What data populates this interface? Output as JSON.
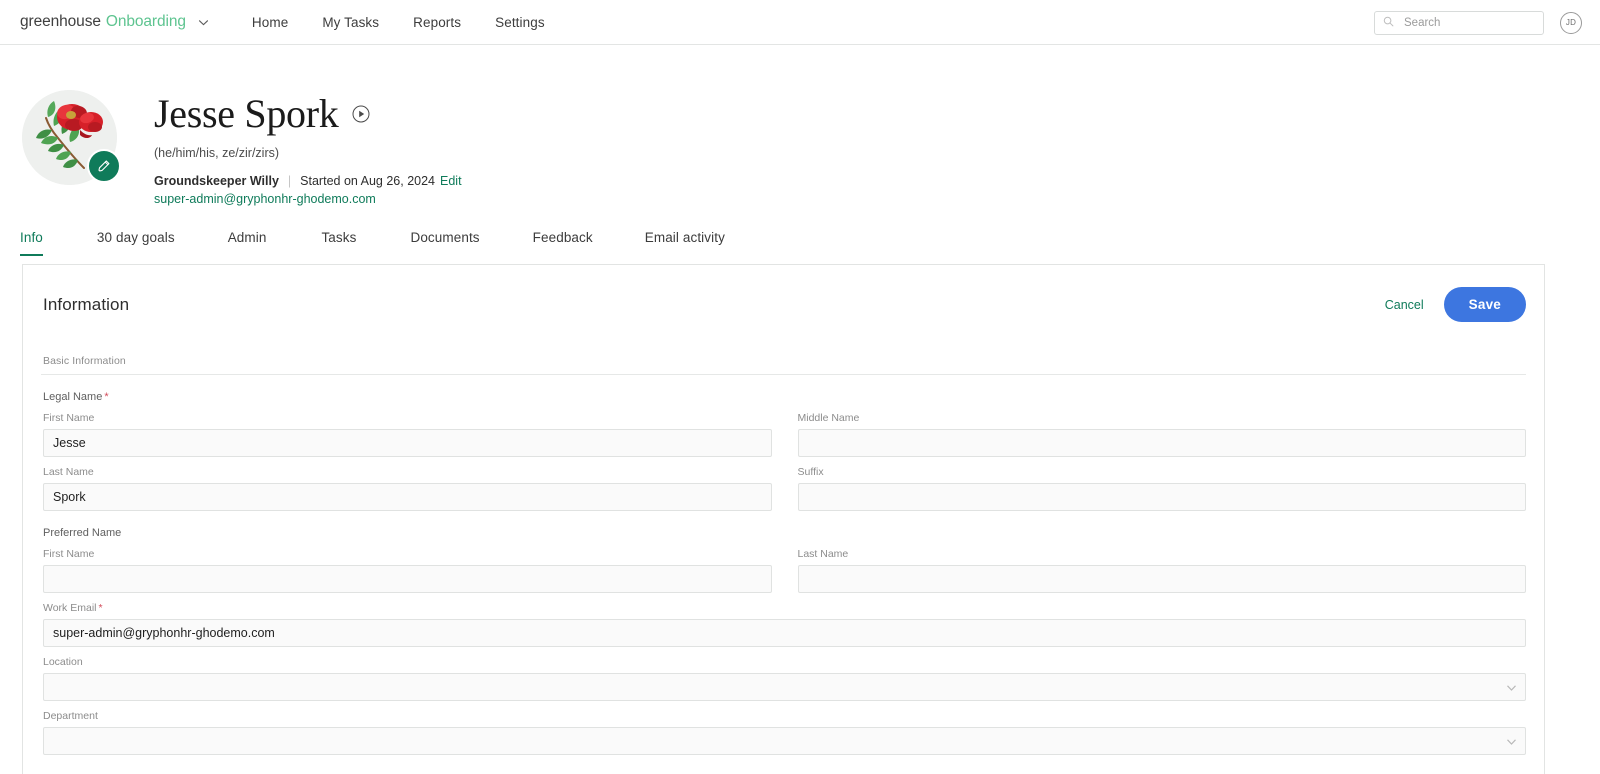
{
  "nav": {
    "brand_company": "greenhouse",
    "brand_product": "Onboarding",
    "brand_caret_icon": "chevron-down-icon",
    "links": [
      {
        "label": "Home"
      },
      {
        "label": "My Tasks"
      },
      {
        "label": "Reports"
      },
      {
        "label": "Settings"
      }
    ],
    "search": {
      "icon": "search-icon",
      "placeholder": "Search",
      "value": ""
    },
    "avatar_initials": "JD"
  },
  "profile": {
    "avatar_alt": "red-flower-illustration-avatar",
    "edit_badge_icon": "pencil-icon",
    "name": "Jesse Spork",
    "pronunciation_icon": "play-icon",
    "pronouns": "(he/him/his, ze/zir/zirs)",
    "job_title": "Groundskeeper Willy",
    "divider": "|",
    "started_on": "Started on Aug 26, 2024",
    "edit_link": "Edit",
    "email": "super-admin@gryphonhr-ghodemo.com"
  },
  "tabs": [
    {
      "label": "Info",
      "active": true
    },
    {
      "label": "30 day goals",
      "active": false
    },
    {
      "label": "Admin",
      "active": false
    },
    {
      "label": "Tasks",
      "active": false
    },
    {
      "label": "Documents",
      "active": false
    },
    {
      "label": "Feedback",
      "active": false
    },
    {
      "label": "Email activity",
      "active": false
    }
  ],
  "card": {
    "title": "Information",
    "cancel_label": "Cancel",
    "save_label": "Save",
    "section_label": "Basic Information",
    "groups": {
      "legal_name": {
        "label": "Legal Name",
        "required_mark": "*"
      },
      "preferred_name": {
        "label": "Preferred Name",
        "required_mark": ""
      }
    },
    "fields": {
      "first_name": {
        "label": "First Name",
        "value": "Jesse",
        "placeholder": ""
      },
      "middle_name": {
        "label": "Middle Name",
        "value": "",
        "placeholder": ""
      },
      "last_name": {
        "label": "Last Name",
        "value": "Spork",
        "placeholder": ""
      },
      "suffix": {
        "label": "Suffix",
        "value": "",
        "placeholder": ""
      },
      "pref_first_name": {
        "label": "First Name",
        "value": "",
        "placeholder": ""
      },
      "pref_last_name": {
        "label": "Last Name",
        "value": "",
        "placeholder": ""
      },
      "work_email": {
        "label": "Work Email",
        "required_mark": "*",
        "value": "super-admin@gryphonhr-ghodemo.com",
        "placeholder": ""
      },
      "location": {
        "label": "Location",
        "value": "",
        "caret_icon": "chevron-down-icon"
      },
      "department": {
        "label": "Department",
        "value": "",
        "caret_icon": "chevron-down-icon"
      }
    }
  },
  "colors": {
    "brand_green": "#5ec490",
    "accent_green": "#0f7b5a",
    "save_blue": "#3d76e0",
    "required_red": "#d24b5a",
    "field_bg": "#fafafa",
    "border": "#e0e2e1"
  }
}
